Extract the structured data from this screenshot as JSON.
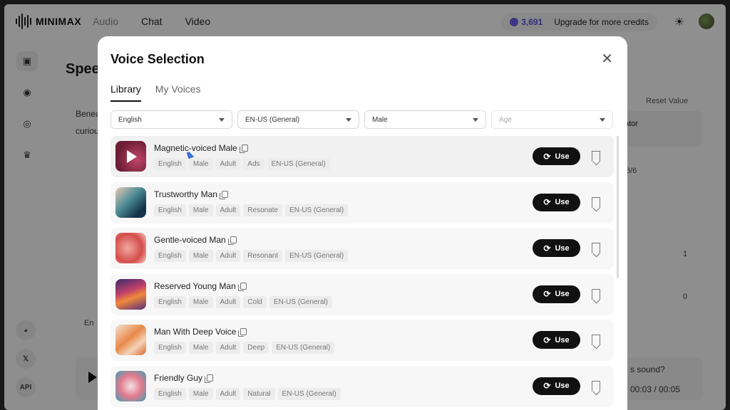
{
  "app": {
    "brand": "MINIMAX",
    "nav": [
      "Audio",
      "Chat",
      "Video"
    ],
    "credits": "3,691",
    "upgrade": "Upgrade for more credits"
  },
  "background": {
    "title": "Spee",
    "text_line1": "Benea",
    "text_line2": "curiou",
    "reset": "Reset Value",
    "panel_text": "ator",
    "count": "6/6",
    "val1": "1",
    "val2": "0",
    "lang": "En",
    "question": "s sound?",
    "time": "00:03 / 00:05",
    "social": [
      "Discord",
      "X",
      "API"
    ]
  },
  "modal": {
    "title": "Voice Selection",
    "tabs": [
      "Library",
      "My Voices"
    ],
    "filters": {
      "language": "English",
      "accent": "EN-US (General)",
      "gender": "Male",
      "age_placeholder": "Age"
    },
    "use_label": "Use",
    "voices": [
      {
        "name": "Magnetic-voiced Male",
        "tags": [
          "English",
          "Male",
          "Adult",
          "Ads",
          "EN-US (General)"
        ]
      },
      {
        "name": "Trustworthy Man",
        "tags": [
          "English",
          "Male",
          "Adult",
          "Resonate",
          "EN-US (General)"
        ]
      },
      {
        "name": "Gentle-voiced Man",
        "tags": [
          "English",
          "Male",
          "Adult",
          "Resonant",
          "EN-US (General)"
        ]
      },
      {
        "name": "Reserved Young Man",
        "tags": [
          "English",
          "Male",
          "Adult",
          "Cold",
          "EN-US (General)"
        ]
      },
      {
        "name": "Man With Deep Voice",
        "tags": [
          "English",
          "Male",
          "Adult",
          "Deep",
          "EN-US (General)"
        ]
      },
      {
        "name": "Friendly Guy",
        "tags": [
          "English",
          "Male",
          "Adult",
          "Natural",
          "EN-US (General)"
        ]
      }
    ]
  }
}
